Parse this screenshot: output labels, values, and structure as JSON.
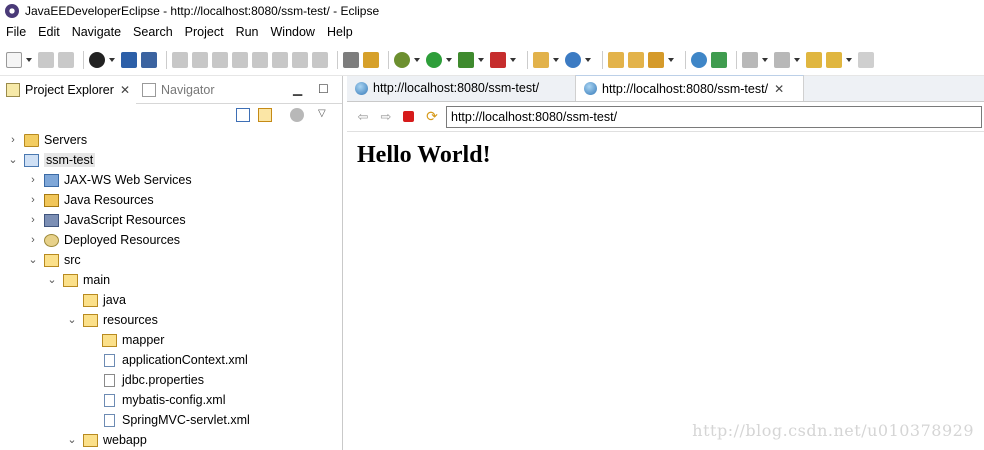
{
  "window": {
    "title": "JavaEEDeveloperEclipse - http://localhost:8080/ssm-test/ - Eclipse"
  },
  "menu": [
    "File",
    "Edit",
    "Navigate",
    "Search",
    "Project",
    "Run",
    "Window",
    "Help"
  ],
  "left_pane": {
    "tabs": [
      {
        "label": "Project Explorer",
        "icon": "project-explorer-icon",
        "active": true
      },
      {
        "label": "Navigator",
        "icon": "navigator-icon",
        "active": false
      }
    ],
    "tree": [
      {
        "label": "Servers",
        "icon": "folder-icon",
        "expand": "collapsed",
        "depth": 0
      },
      {
        "label": "ssm-test",
        "icon": "web-project-icon",
        "expand": "expanded",
        "depth": 0,
        "selected": true
      },
      {
        "label": "JAX-WS Web Services",
        "icon": "web-services-icon",
        "expand": "collapsed",
        "depth": 1
      },
      {
        "label": "Java Resources",
        "icon": "java-resources-icon",
        "expand": "collapsed",
        "depth": 1
      },
      {
        "label": "JavaScript Resources",
        "icon": "javascript-resources-icon",
        "expand": "collapsed",
        "depth": 1
      },
      {
        "label": "Deployed Resources",
        "icon": "deployed-resources-icon",
        "expand": "collapsed",
        "depth": 1
      },
      {
        "label": "src",
        "icon": "folder-icon",
        "expand": "expanded",
        "depth": 1
      },
      {
        "label": "main",
        "icon": "folder-icon",
        "expand": "expanded",
        "depth": 2
      },
      {
        "label": "java",
        "icon": "folder-icon",
        "expand": "none",
        "depth": 3
      },
      {
        "label": "resources",
        "icon": "folder-icon",
        "expand": "expanded",
        "depth": 3
      },
      {
        "label": "mapper",
        "icon": "folder-icon",
        "expand": "none",
        "depth": 4
      },
      {
        "label": "applicationContext.xml",
        "icon": "xml-file-icon",
        "expand": "none",
        "depth": 4
      },
      {
        "label": "jdbc.properties",
        "icon": "properties-file-icon",
        "expand": "none",
        "depth": 4
      },
      {
        "label": "mybatis-config.xml",
        "icon": "xml-file-icon",
        "expand": "none",
        "depth": 4
      },
      {
        "label": "SpringMVC-servlet.xml",
        "icon": "xml-file-icon",
        "expand": "none",
        "depth": 4
      },
      {
        "label": "webapp",
        "icon": "folder-icon",
        "expand": "expanded",
        "depth": 3
      }
    ]
  },
  "editor": {
    "tabs": [
      {
        "label": "http://localhost:8080/ssm-test/",
        "active": false
      },
      {
        "label": "http://localhost:8080/ssm-test/",
        "active": true
      }
    ],
    "url": "http://localhost:8080/ssm-test/",
    "page_heading": "Hello World!"
  },
  "watermark": "http://blog.csdn.net/u010378929"
}
